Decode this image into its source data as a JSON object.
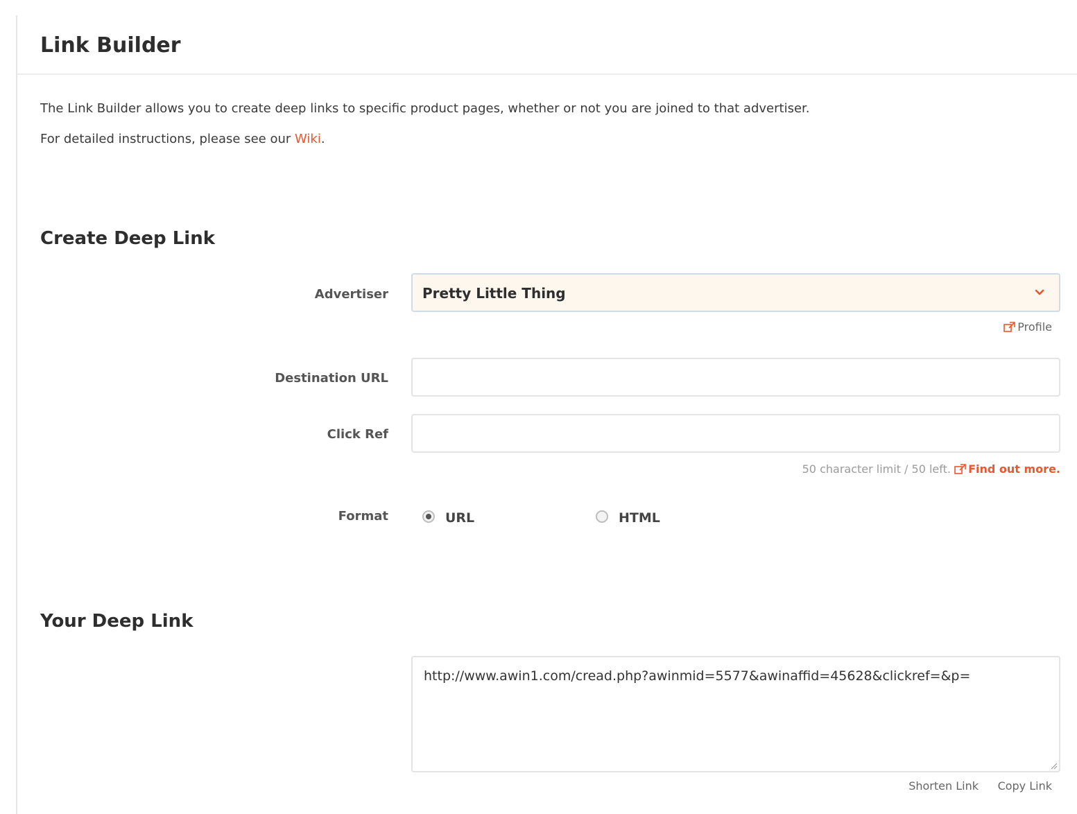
{
  "header": {
    "title": "Link Builder"
  },
  "intro": {
    "line1": "The Link Builder allows you to create deep links to specific product pages, whether or not you are joined to that advertiser.",
    "line2_prefix": "For detailed instructions, please see our ",
    "line2_link": "Wiki",
    "line2_suffix": "."
  },
  "create_section": {
    "title": "Create Deep Link",
    "advertiser": {
      "label": "Advertiser",
      "selected": "Pretty Little Thing",
      "icon": "chevron-down-icon",
      "profile_link": "Profile"
    },
    "destination_url": {
      "label": "Destination URL",
      "value": "",
      "placeholder": ""
    },
    "click_ref": {
      "label": "Click Ref",
      "value": "",
      "placeholder": "",
      "hint": "50 character limit / 50 left.",
      "find_out_more": "Find out more."
    },
    "format": {
      "label": "Format",
      "options": [
        {
          "label": "URL",
          "selected": true
        },
        {
          "label": "HTML",
          "selected": false
        }
      ]
    }
  },
  "result_section": {
    "title": "Your Deep Link",
    "link": "http://www.awin1.com/cread.php?awinmid=5577&awinaffid=45628&clickref=&p=",
    "shorten_label": "Shorten Link",
    "copy_label": "Copy Link"
  },
  "colors": {
    "accent": "#e8572f",
    "select_background": "#fdf7ee",
    "select_border": "#cfdbe6"
  }
}
